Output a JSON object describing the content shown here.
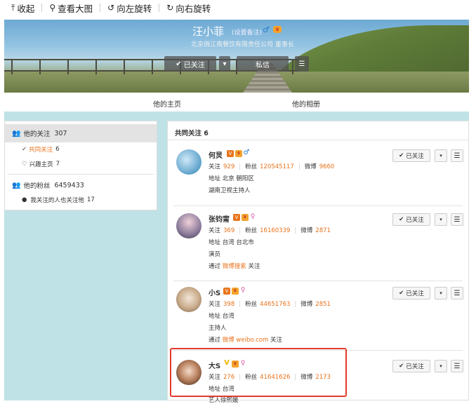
{
  "toolbar": {
    "items": [
      {
        "icon": "upload-icon",
        "glyph": "⤒",
        "label": "收起"
      },
      {
        "icon": "magnify-icon",
        "glyph": "⚲",
        "label": "查看大图"
      },
      {
        "icon": "rotate-left-icon",
        "glyph": "↺",
        "label": "向左旋转"
      },
      {
        "icon": "rotate-right-icon",
        "glyph": "↻",
        "label": "向右旋转"
      }
    ]
  },
  "profile": {
    "name": "汪小菲",
    "remark": "(设置备注)",
    "gender": "♂",
    "title": "北京俏江南餐饮有限责任公司 董事长",
    "buttons": {
      "followed": "已关注",
      "dropdown": "▾",
      "message": "私信",
      "menu": "☰"
    }
  },
  "tabs": {
    "home": "他的主页",
    "album": "他的相册"
  },
  "left": {
    "following_label": "他的关注",
    "following_count": "307",
    "mutual_label": "共同关注",
    "mutual_count": "6",
    "interest_label": "兴趣主页",
    "interest_count": "7",
    "fans_label": "他的粉丝",
    "fans_count": "6459433",
    "fans_sub": "我关注的人也关注他",
    "fans_sub_count": "17"
  },
  "right": {
    "header": "共同关注 6",
    "cards": [
      {
        "name": "何炅",
        "gender": "♂",
        "vtype": "orange",
        "follow_label": "关注",
        "follow": "929",
        "fans_label": "粉丝",
        "fans": "120545117",
        "weibo_label": "微博",
        "weibo": "9660",
        "addr_label": "地址",
        "addr": "北京 朝阳区",
        "bio": "湖南卫视主持人",
        "via": "",
        "via_link": "",
        "via_suffix": ""
      },
      {
        "name": "张钧甯",
        "gender": "♀",
        "vtype": "orange",
        "follow_label": "关注",
        "follow": "369",
        "fans_label": "粉丝",
        "fans": "16160339",
        "weibo_label": "微博",
        "weibo": "2871",
        "addr_label": "地址",
        "addr": "台湾 台北市",
        "bio": "演员",
        "via": "通过",
        "via_link": "微博搜索",
        "via_suffix": "关注"
      },
      {
        "name": "小S",
        "gender": "♀",
        "vtype": "orange",
        "follow_label": "关注",
        "follow": "398",
        "fans_label": "粉丝",
        "fans": "44651763",
        "weibo_label": "微博",
        "weibo": "2851",
        "addr_label": "地址",
        "addr": "台湾",
        "bio": "主持人",
        "via": "通过",
        "via_link": "微博 weibo.com",
        "via_suffix": "关注"
      },
      {
        "name": "大S",
        "gender": "♀",
        "vtype": "yellow",
        "follow_label": "关注",
        "follow": "276",
        "fans_label": "粉丝",
        "fans": "41641626",
        "weibo_label": "微博",
        "weibo": "2173",
        "addr_label": "地址",
        "addr": "台湾",
        "bio": "艺人徐熙媛",
        "via": "",
        "via_link": "",
        "via_suffix": ""
      }
    ],
    "followed_label": "已关注",
    "check": "✔",
    "dropdown": "▾",
    "menu": "☰"
  },
  "colors": {
    "accent": "#e8711a",
    "highlight": "#e23a2c",
    "bg": "#bfe2e6"
  }
}
